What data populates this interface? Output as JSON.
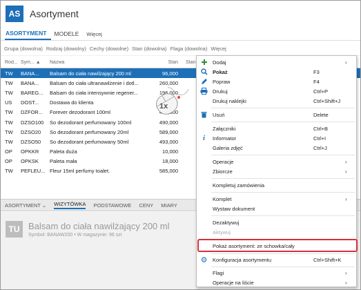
{
  "app": {
    "badge": "AS",
    "title": "Asortyment"
  },
  "tabs": [
    {
      "label": "ASORTYMENT",
      "active": true
    },
    {
      "label": "MODELE",
      "active": false
    },
    {
      "label": "Więcej",
      "active": false
    }
  ],
  "filters": [
    "Grupa (dowolna)",
    "Rodzaj (dowolny)",
    "Cechy (dowolne)",
    "Stan (dowolna)",
    "Flaga (dowolna)",
    "Więcej"
  ],
  "grid": {
    "headers": [
      "Rod...",
      "Sym... ▲",
      "Nazwa",
      "Stan",
      "Stan"
    ],
    "rows": [
      {
        "rod": "TW",
        "sym": "BANA...",
        "nazwa": "Balsam do ciała nawilżający 200 ml",
        "stan": "96,000",
        "selected": true
      },
      {
        "rod": "TW",
        "sym": "BANA...",
        "nazwa": "Balsam do ciała ultranawilżenie i dotl...",
        "stan": "260,000"
      },
      {
        "rod": "TW",
        "sym": "BAREG...",
        "nazwa": "Balsam do ciała intensywnie regener...",
        "stan": "196,000"
      },
      {
        "rod": "US",
        "sym": "DOST...",
        "nazwa": "Dostawa do klienta",
        "stan": ""
      },
      {
        "rod": "TW",
        "sym": "DZFOR...",
        "nazwa": "Forever dezodorant 100ml",
        "stan": "461,000"
      },
      {
        "rod": "TW",
        "sym": "DZSO100",
        "nazwa": "So dezodorant perfumowany 100ml",
        "stan": "490,000"
      },
      {
        "rod": "TW",
        "sym": "DZSO20",
        "nazwa": "So dezodorant perfumowany 20ml",
        "stan": "589,000"
      },
      {
        "rod": "TW",
        "sym": "DZSO50",
        "nazwa": "So dezodorant perfumowany 50ml",
        "stan": "493,000"
      },
      {
        "rod": "OP",
        "sym": "OPKKR",
        "nazwa": "Paleta duża",
        "stan": "10,000"
      },
      {
        "rod": "OP",
        "sym": "OPKSK",
        "nazwa": "Paleta mała",
        "stan": "18,000"
      },
      {
        "rod": "TW",
        "sym": "PEFLEU...",
        "nazwa": "Fleur 15ml perfumy toalet.",
        "stan": "585,000"
      }
    ]
  },
  "bottom_tabs": [
    {
      "label": "ASORTYMENT ⌄",
      "active": false
    },
    {
      "label": "WIZYTÓWKA",
      "active": true
    },
    {
      "label": "PODSTAWOWE",
      "active": false
    },
    {
      "label": "CENY",
      "active": false
    },
    {
      "label": "MIARY",
      "active": false
    }
  ],
  "detail": {
    "badge": "TU",
    "title": "Balsam do ciała nawilżający 200 ml",
    "subtitle": "Symbol: BANAW200 • W magazynie: 96 szt"
  },
  "mouse_label": "1x",
  "menu": {
    "items": [
      {
        "label": "Dodaj",
        "shortcut": "",
        "icon": "plus-icon",
        "submenu": true
      },
      {
        "label": "Pokaż",
        "shortcut": "F3",
        "icon": "search-icon",
        "bold": true
      },
      {
        "label": "Popraw",
        "shortcut": "F4",
        "icon": "pencil-icon"
      },
      {
        "label": "Drukuj",
        "shortcut": "Ctrl+P",
        "icon": "printer-icon"
      },
      {
        "label": "Drukuj naklejki",
        "shortcut": "Ctrl+Shift+J"
      },
      {
        "label": "Usuń",
        "shortcut": "Delete",
        "icon": "trash-icon"
      },
      {
        "label": "Załączniki",
        "shortcut": "Ctrl+B"
      },
      {
        "label": "Informator",
        "shortcut": "Ctrl+I",
        "icon": "info-icon"
      },
      {
        "label": "Galeria zdjęć",
        "shortcut": "Ctrl+J"
      },
      {
        "label": "Operacje",
        "shortcut": "",
        "submenu": true
      },
      {
        "label": "Zbiorcze",
        "shortcut": "",
        "submenu": true
      },
      {
        "label": "Kompletuj zamówienia",
        "shortcut": ""
      },
      {
        "label": "Komplet",
        "shortcut": "",
        "submenu": true
      },
      {
        "label": "Wystaw dokument",
        "shortcut": ""
      },
      {
        "label": "Dezaktywuj",
        "shortcut": ""
      },
      {
        "label": "Aktywuj",
        "shortcut": "",
        "disabled": true
      },
      {
        "label": "Pokaż asortyment: ze schowka/cały",
        "shortcut": "",
        "highlighted": true
      },
      {
        "label": "Konfiguracja asortymentu",
        "shortcut": "Ctrl+Shift+K",
        "icon": "gear-icon"
      },
      {
        "label": "Flagi",
        "shortcut": "",
        "submenu": true
      },
      {
        "label": "Operacje na liście",
        "shortcut": "",
        "submenu": true
      }
    ]
  },
  "colors": {
    "accent": "#1d6fb8",
    "highlight": "#d5303a",
    "plus": "#2e8b3a"
  }
}
